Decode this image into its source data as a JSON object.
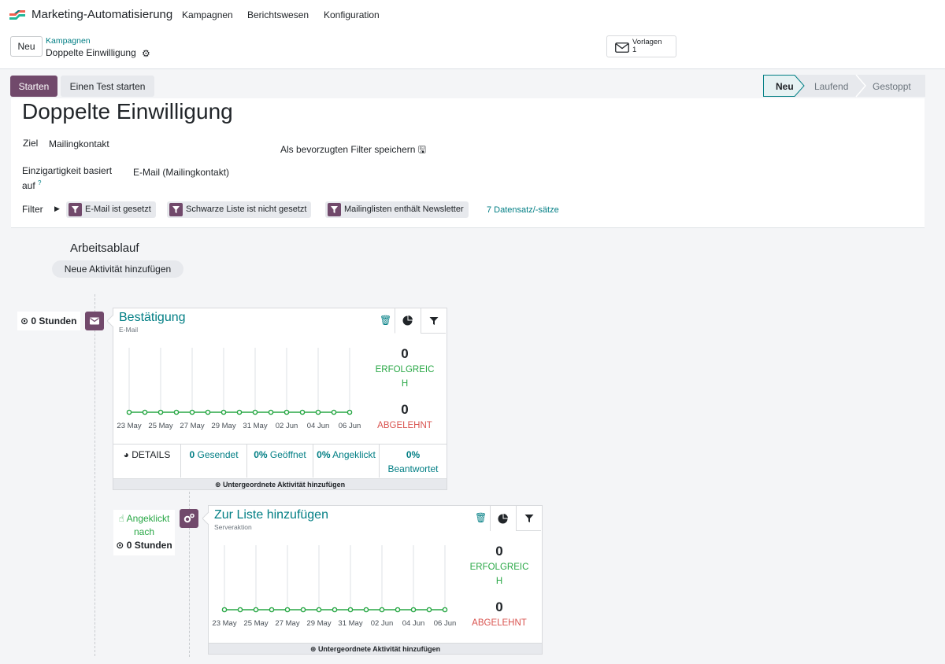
{
  "app": {
    "title": "Marketing-Automatisierung",
    "nav": [
      "Kampagnen",
      "Berichtswesen",
      "Konfiguration"
    ]
  },
  "control": {
    "new_label": "Neu",
    "breadcrumb_parent": "Kampagnen",
    "breadcrumb_current": "Doppelte Einwilligung",
    "templates_label": "Vorlagen",
    "templates_count": "1"
  },
  "actions": {
    "start": "Starten",
    "test": "Einen Test starten"
  },
  "stages": [
    "Neu",
    "Laufend",
    "Gestoppt"
  ],
  "stages_active": "Neu",
  "form": {
    "title": "Doppelte Einwilligung",
    "target_label": "Ziel",
    "target_value": "Mailingkontakt",
    "save_filter_label": "Als bevorzugten Filter speichern",
    "unique_label_1": "Einzigartigkeit basiert",
    "unique_label_2": "auf",
    "unique_help": "?",
    "unique_value": "E-Mail (Mailingkontakt)",
    "filter_label": "Filter",
    "filters": [
      "E-Mail ist gesetzt",
      "Schwarze Liste ist nicht gesetzt",
      "Mailinglisten enthält Newsletter"
    ],
    "records_link": "7 Datensatz/-sätze"
  },
  "workflow": {
    "title": "Arbeitsablauf",
    "add_activity": "Neue Aktivität hinzufügen",
    "activities": [
      {
        "trigger_time": "0 Stunden",
        "title": "Bestätigung",
        "subtitle": "E-Mail",
        "success_count": "0",
        "success_label_1": "ERFOLGREIC",
        "success_label_2": "H",
        "rejected_count": "0",
        "rejected_label": "ABGELEHNT",
        "details_label": "DETAILS",
        "stats": [
          {
            "value": "0",
            "label": "Gesendet"
          },
          {
            "value": "0%",
            "label": "Geöffnet"
          },
          {
            "value": "0%",
            "label": "Angeklickt"
          },
          {
            "value": "0%",
            "label": "Beantwortet"
          }
        ],
        "add_child": "Untergeordnete Aktivität hinzufügen"
      },
      {
        "trigger_event_1": "Angeklickt",
        "trigger_event_2": "nach",
        "trigger_time": "0 Stunden",
        "title": "Zur Liste hinzufügen",
        "subtitle": "Serveraktion",
        "success_count": "0",
        "success_label_1": "ERFOLGREIC",
        "success_label_2": "H",
        "rejected_count": "0",
        "rejected_label": "ABGELEHNT",
        "add_child": "Untergeordnete Aktivität hinzufügen"
      }
    ]
  },
  "colors": {
    "accent": "#71496b",
    "link": "#017e84",
    "success": "#28a745",
    "danger": "#d9534f"
  },
  "chart_data": [
    {
      "type": "line",
      "x": [
        "23 May",
        "24 May",
        "25 May",
        "26 May",
        "27 May",
        "28 May",
        "29 May",
        "30 May",
        "31 May",
        "01 Jun",
        "02 Jun",
        "03 Jun",
        "04 Jun",
        "05 Jun",
        "06 Jun"
      ],
      "tick_labels": [
        "23 May",
        "25 May",
        "27 May",
        "29 May",
        "31 May",
        "02 Jun",
        "04 Jun",
        "06 Jun"
      ],
      "series": [
        {
          "values": [
            0,
            0,
            0,
            0,
            0,
            0,
            0,
            0,
            0,
            0,
            0,
            0,
            0,
            0,
            0
          ],
          "color": "#28a745"
        }
      ],
      "grid": true
    },
    {
      "type": "line",
      "x": [
        "23 May",
        "24 May",
        "25 May",
        "26 May",
        "27 May",
        "28 May",
        "29 May",
        "30 May",
        "31 May",
        "01 Jun",
        "02 Jun",
        "03 Jun",
        "04 Jun",
        "05 Jun",
        "06 Jun"
      ],
      "tick_labels": [
        "23 May",
        "25 May",
        "27 May",
        "29 May",
        "31 May",
        "02 Jun",
        "04 Jun",
        "06 Jun"
      ],
      "series": [
        {
          "values": [
            0,
            0,
            0,
            0,
            0,
            0,
            0,
            0,
            0,
            0,
            0,
            0,
            0,
            0,
            0
          ],
          "color": "#28a745"
        }
      ],
      "grid": true
    }
  ]
}
